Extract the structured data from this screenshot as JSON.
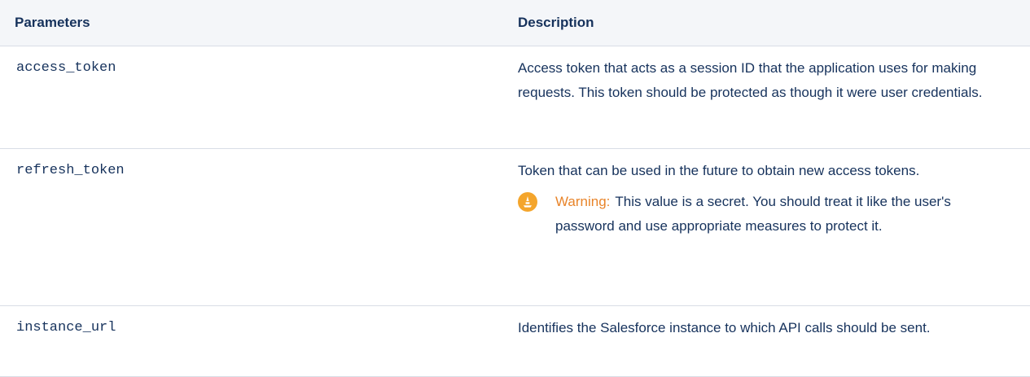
{
  "table": {
    "headers": {
      "parameters": "Parameters",
      "description": "Description"
    },
    "rows": [
      {
        "parameter": "access_token",
        "description": "Access token that acts as a session ID that the application uses for making requests. This token should be protected as though it were user credentials."
      },
      {
        "parameter": "refresh_token",
        "description": "Token that can be used in the future to obtain new access tokens.",
        "warning": {
          "icon": "warning-icon",
          "label": "Warning:",
          "text": "This value is a secret. You should treat it like the user's password and use appropriate measures to protect it."
        }
      },
      {
        "parameter": "instance_url",
        "description": "Identifies the Salesforce instance to which API calls should be sent."
      }
    ]
  },
  "colors": {
    "text": "#16325c",
    "header_bg": "#f4f6f9",
    "border": "#d8dde6",
    "warning_label": "#e8842a",
    "warning_icon": "#f4a52c"
  }
}
